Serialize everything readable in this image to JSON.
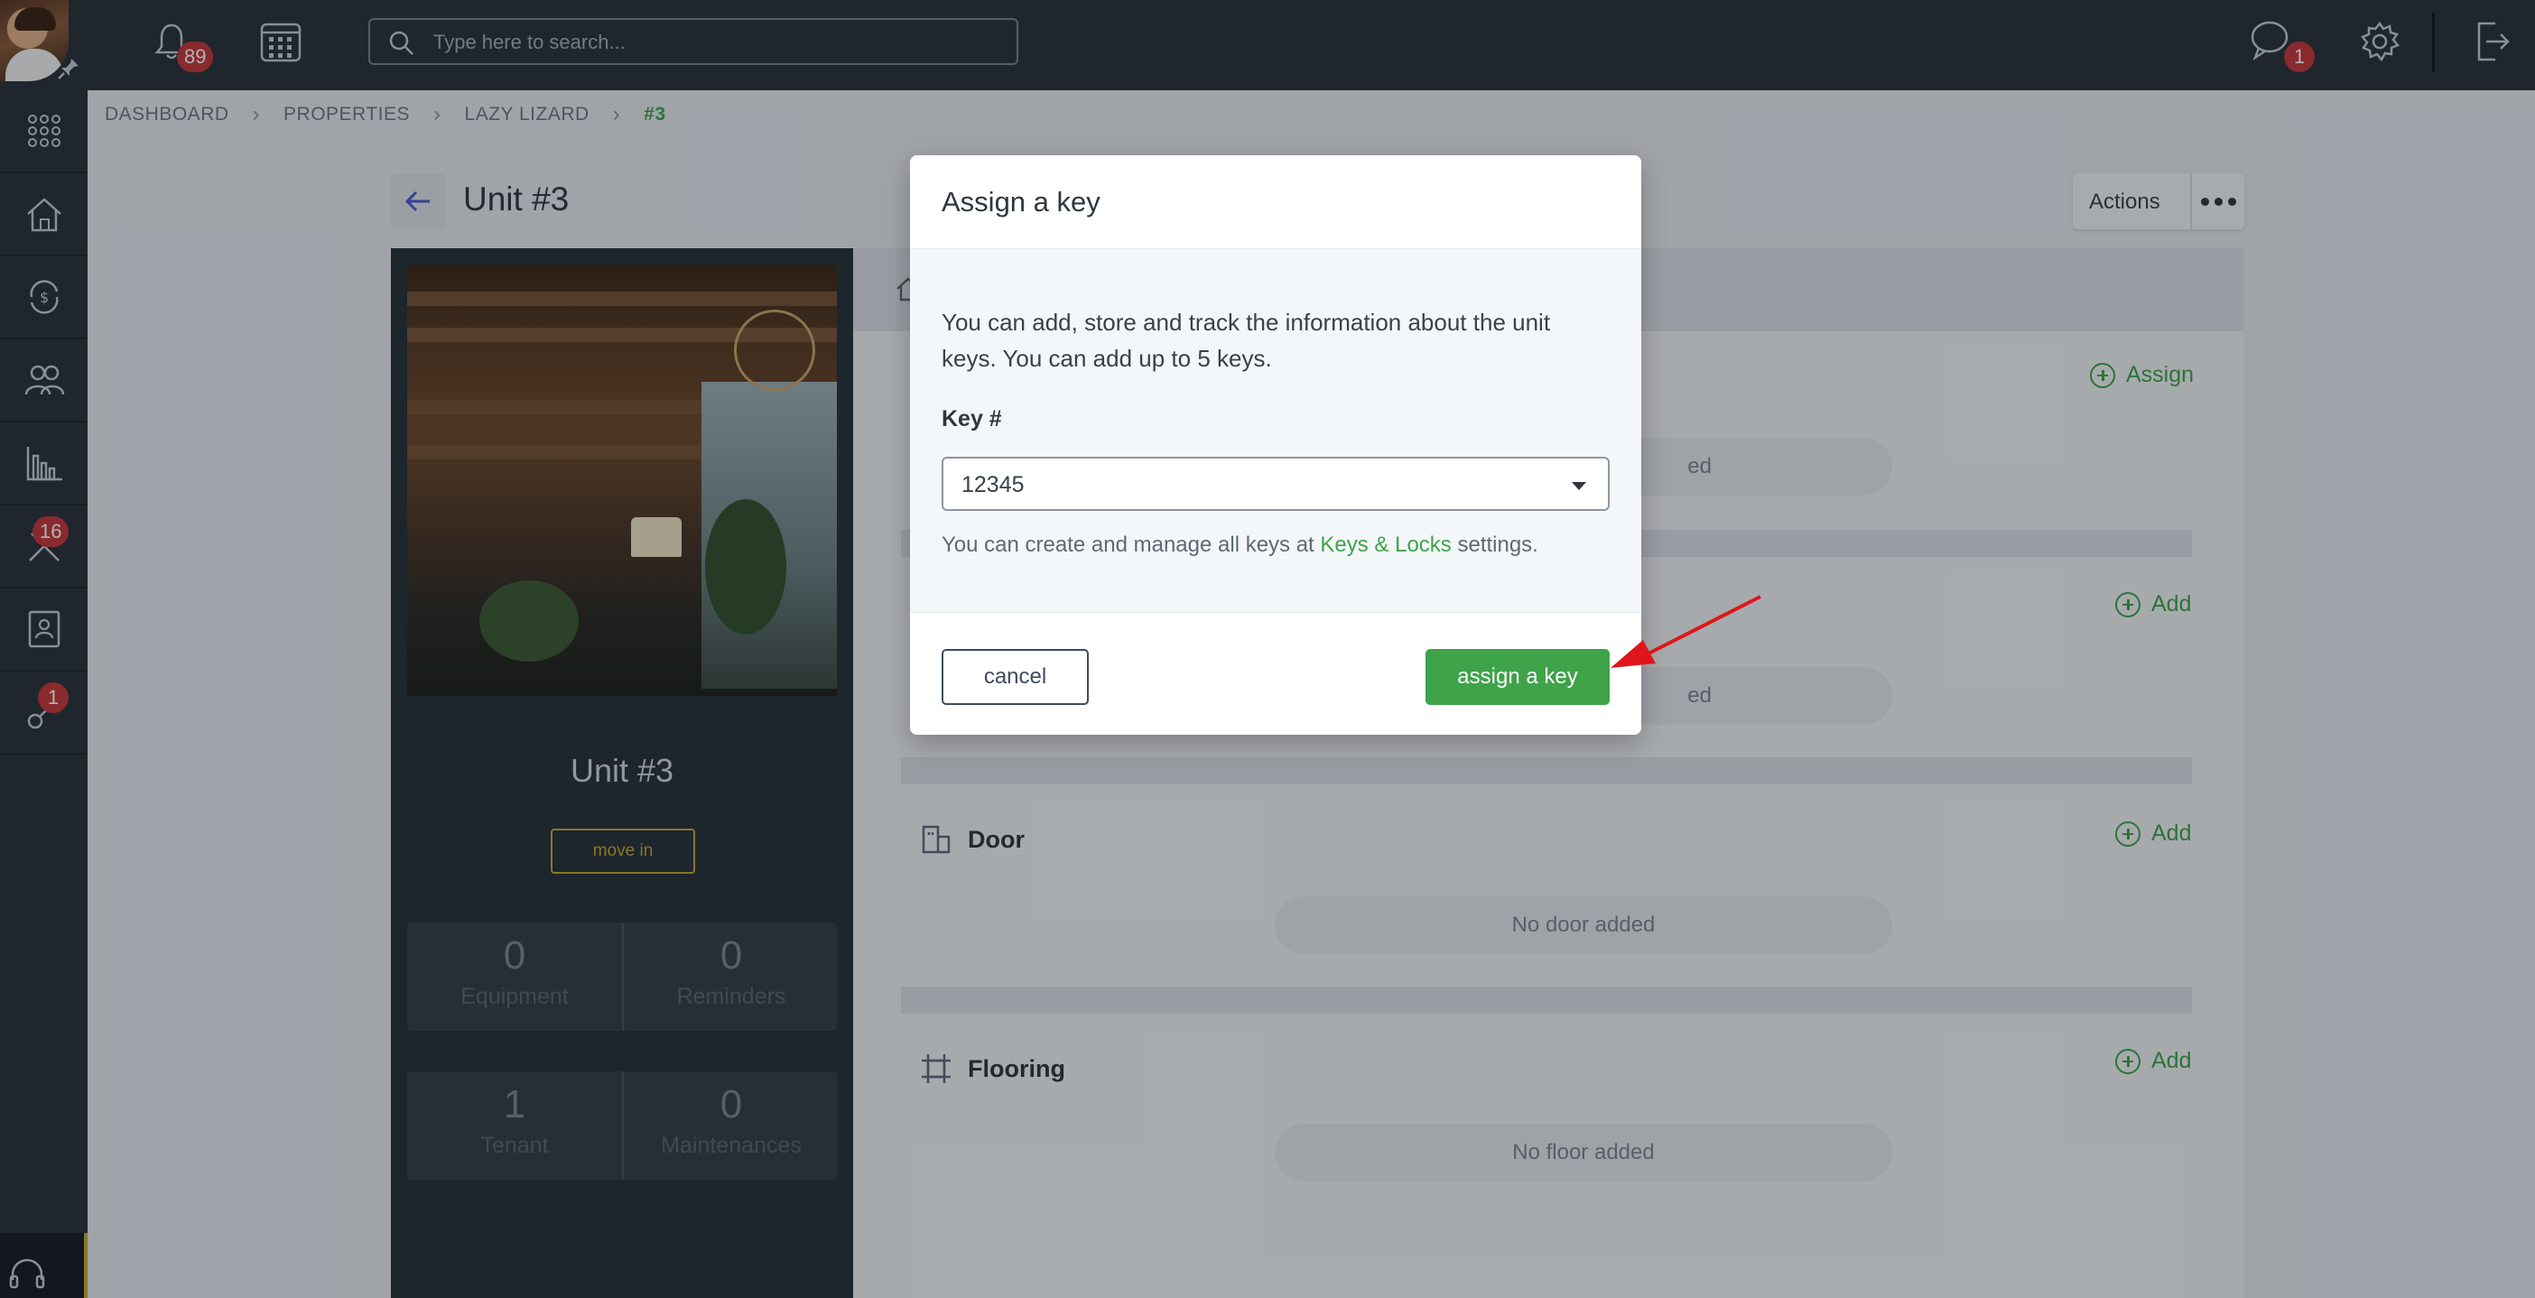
{
  "topbar": {
    "notifications_count": "89",
    "search_placeholder": "Type here to search...",
    "messages_count": "1"
  },
  "sidebar": {
    "maintenance_badge": "16",
    "keys_badge": "1"
  },
  "breadcrumb": {
    "items": [
      "DASHBOARD",
      "PROPERTIES",
      "LAZY LIZARD",
      "#3"
    ]
  },
  "page": {
    "title": "Unit #3",
    "actions_label": "Actions"
  },
  "unit_panel": {
    "name": "Unit #3",
    "move_in_label": "move in",
    "stats": [
      {
        "value": "0",
        "label": "Equipment"
      },
      {
        "value": "0",
        "label": "Reminders"
      },
      {
        "value": "1",
        "label": "Tenant"
      },
      {
        "value": "0",
        "label": "Maintenances"
      }
    ]
  },
  "content": {
    "keys_action": "Assign",
    "keys_empty_partial": "ed",
    "second_action": "Add",
    "second_empty_partial": "ed",
    "door": {
      "title": "Door",
      "action": "Add",
      "empty": "No door added"
    },
    "flooring": {
      "title": "Flooring",
      "action": "Add",
      "empty": "No floor added"
    }
  },
  "modal": {
    "title": "Assign a key",
    "description": "You can add, store and track the information about the unit keys. You can add up to 5 keys.",
    "key_label": "Key #",
    "key_value": "12345",
    "helper_prefix": "You can create and manage all keys at ",
    "helper_link": "Keys & Locks",
    "helper_suffix": " settings.",
    "cancel_label": "cancel",
    "assign_label": "assign a key"
  },
  "colors": {
    "accent_green": "#3fa34a",
    "dark_nav": "#2b323c",
    "badge_red": "#c6373c",
    "annotation_arrow": "#e0151c"
  }
}
